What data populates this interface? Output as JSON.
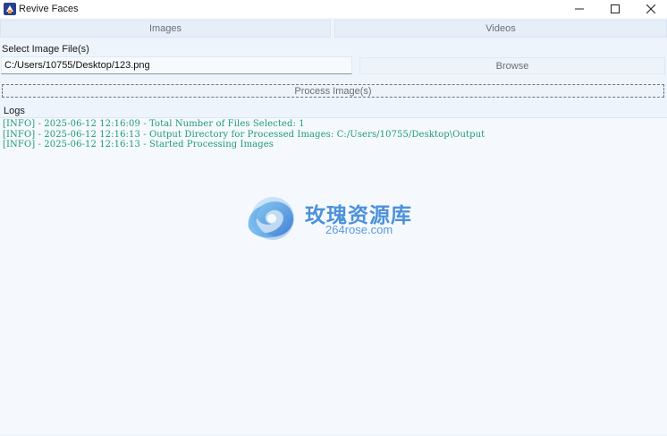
{
  "window": {
    "title": "Revive Faces",
    "icon": "app-icon",
    "controls": {
      "minimize": "minimize-icon",
      "maximize": "maximize-icon",
      "close": "close-icon"
    }
  },
  "tabs": [
    {
      "label": "Images"
    },
    {
      "label": "Videos"
    }
  ],
  "select_file": {
    "label": "Select Image File(s)",
    "value": "C:/Users/10755/Desktop/123.png",
    "browse_label": "Browse"
  },
  "process": {
    "label": "Process Image(s)"
  },
  "logs": {
    "label": "Logs",
    "lines": [
      "[INFO] - 2025-06-12 12:16:09 - Total Number of Files Selected: 1",
      "[INFO] - 2025-06-12 12:16:13 - Output Directory for Processed Images: C:/Users/10755/Desktop\\Output",
      "[INFO] - 2025-06-12 12:16:13 - Started Processing Images"
    ]
  },
  "watermark": {
    "cn_text": "玫瑰资源库",
    "en_text": "264rose.com"
  },
  "colors": {
    "log_text": "#1f9a7a",
    "window_bg": "#eef4fb",
    "watermark": "#3a86d9"
  }
}
